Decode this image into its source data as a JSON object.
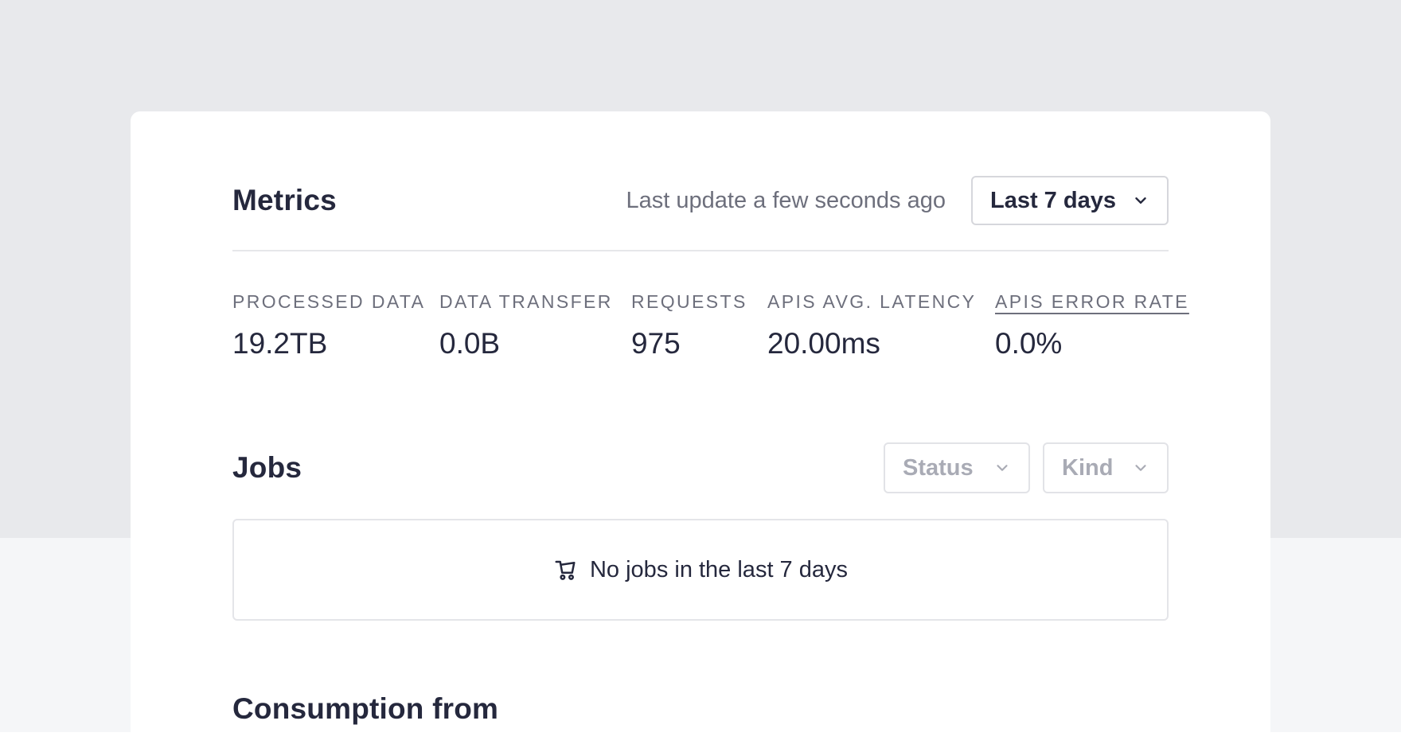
{
  "metrics": {
    "title": "Metrics",
    "last_update": "Last update a few seconds ago",
    "range": {
      "label": "Last 7 days"
    },
    "items": [
      {
        "label": "PROCESSED DATA",
        "value": "19.2TB"
      },
      {
        "label": "DATA TRANSFER",
        "value": "0.0B"
      },
      {
        "label": "REQUESTS",
        "value": "975"
      },
      {
        "label": "APIS AVG. LATENCY",
        "value": "20.00ms"
      },
      {
        "label": "APIS ERROR RATE",
        "value": "0.0%"
      }
    ]
  },
  "jobs": {
    "title": "Jobs",
    "filters": {
      "status": "Status",
      "kind": "Kind"
    },
    "empty_message": "No jobs in the last 7 days"
  },
  "consumption": {
    "title": "Consumption from"
  },
  "colors": {
    "page_bg_top": "#e8e9ec",
    "page_bg_bottom": "#f5f6f8",
    "card_bg": "#ffffff",
    "text_primary": "#25283d",
    "text_muted": "#6d6f7c",
    "text_placeholder": "#a9abb5",
    "border": "#d6d7dc"
  },
  "icons": {
    "range_chevron": "chevron-down-icon",
    "empty_state": "cart-icon"
  }
}
